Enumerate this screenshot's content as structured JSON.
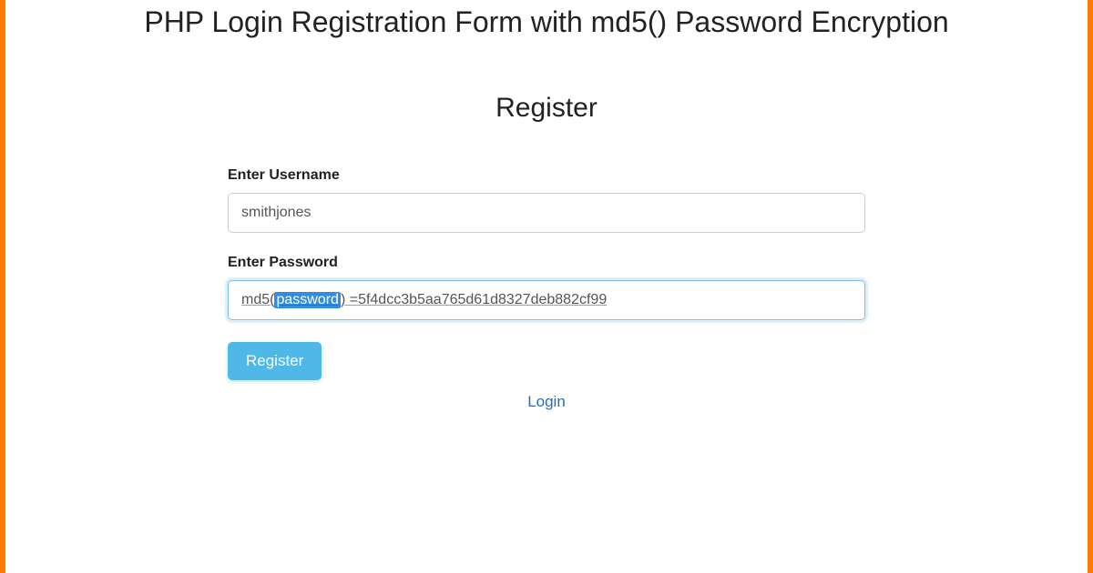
{
  "header": {
    "title": "PHP Login Registration Form with md5() Password Encryption"
  },
  "section": {
    "heading": "Register"
  },
  "form": {
    "username_label": "Enter Username",
    "username_value": "smithjones",
    "password_label": "Enter Password",
    "password_display": {
      "prefix": "md5(",
      "highlighted": "password",
      "middle": ") = ",
      "hash": "5f4dcc3b5aa765d61d8327deb882cf99"
    },
    "register_button": "Register",
    "login_link": "Login"
  }
}
